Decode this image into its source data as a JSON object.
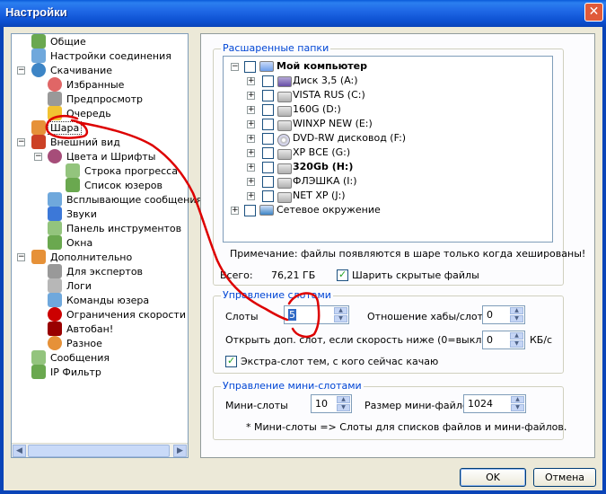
{
  "window": {
    "title": "Настройки",
    "close_glyph": "✕"
  },
  "tree": {
    "items": [
      {
        "label": "Общие",
        "icon": "person-icon",
        "color": "#6aa84f"
      },
      {
        "label": "Настройки соединения",
        "icon": "network-icon",
        "color": "#6fa8dc"
      },
      {
        "label": "Скачивание",
        "icon": "download-globe-icon",
        "color": "#3d85c6"
      },
      {
        "label": "Избранные",
        "icon": "heart-icon",
        "color": "#e06666"
      },
      {
        "label": "Предпросмотр",
        "icon": "preview-icon",
        "color": "#999999"
      },
      {
        "label": "Очередь",
        "icon": "queue-icon",
        "color": "#f1c232"
      },
      {
        "label": "Шара",
        "icon": "share-hand-icon",
        "color": "#e69138"
      },
      {
        "label": "Внешний вид",
        "icon": "appearance-icon",
        "color": "#cc4125"
      },
      {
        "label": "Цвета и Шрифты",
        "icon": "palette-icon",
        "color": "#a64d79"
      },
      {
        "label": "Строка прогресса",
        "icon": "progress-icon",
        "color": "#93c47d"
      },
      {
        "label": "Список юзеров",
        "icon": "users-icon",
        "color": "#6aa84f"
      },
      {
        "label": "Всплывающие сообщения",
        "icon": "popup-icon",
        "color": "#6fa8dc"
      },
      {
        "label": "Звуки",
        "icon": "music-note-icon",
        "color": "#3c78d8"
      },
      {
        "label": "Панель инструментов",
        "icon": "toolbar-icon",
        "color": "#93c47d"
      },
      {
        "label": "Окна",
        "icon": "window-icon",
        "color": "#6aa84f"
      },
      {
        "label": "Дополнительно",
        "icon": "advanced-icon",
        "color": "#e69138"
      },
      {
        "label": "Для экспертов",
        "icon": "expert-icon",
        "color": "#999999"
      },
      {
        "label": "Логи",
        "icon": "log-icon",
        "color": "#b7b7b7"
      },
      {
        "label": "Команды юзера",
        "icon": "commands-icon",
        "color": "#6fa8dc"
      },
      {
        "label": "Ограничения скорости",
        "icon": "speed-limit-icon",
        "color": "#cc0000"
      },
      {
        "label": "Автобан!",
        "icon": "autoban-icon",
        "color": "#990000"
      },
      {
        "label": "Разное",
        "icon": "misc-icon",
        "color": "#e69138"
      },
      {
        "label": "Сообщения",
        "icon": "messages-icon",
        "color": "#93c47d"
      },
      {
        "label": "IP Фильтр",
        "icon": "ip-filter-icon",
        "color": "#6aa84f"
      }
    ]
  },
  "shared_folders": {
    "legend": "Расшаренные папки",
    "items": [
      {
        "label": "Мой компьютер",
        "icon": "computer-icon",
        "bold": true
      },
      {
        "label": "Диск 3,5 (A:)",
        "icon": "floppy-icon"
      },
      {
        "label": "VISTA RUS (C:)",
        "icon": "drive-icon"
      },
      {
        "label": "160G (D:)",
        "icon": "drive-icon"
      },
      {
        "label": "WINXP NEW (E:)",
        "icon": "drive-icon"
      },
      {
        "label": "DVD-RW дисковод (F:)",
        "icon": "dvd-icon"
      },
      {
        "label": "XP ВСЕ (G:)",
        "icon": "drive-icon"
      },
      {
        "label": "320Gb (H:)",
        "icon": "drive-icon",
        "bold": true
      },
      {
        "label": "ФЛЭШКА (I:)",
        "icon": "drive-icon"
      },
      {
        "label": "NET XP (J:)",
        "icon": "drive-icon"
      },
      {
        "label": "Сетевое окружение",
        "icon": "network-places-icon"
      }
    ],
    "note": "Примечание: файлы появляются в шаре только когда хешированы!",
    "total_label": "Всего:",
    "total_value": "76,21 ГБ",
    "share_hidden_label": "Шарить скрытые файлы",
    "share_hidden_checked": true
  },
  "slots": {
    "legend": "Управление слотами",
    "slots_label": "Слоты",
    "slots_value": "5",
    "ratio_label": "Отношение хабы/слоты",
    "ratio_value": "0",
    "extra_slot_label": "Открыть доп. слот, если скорость ниже (0=выкл.)",
    "extra_slot_value": "0",
    "extra_slot_unit": "КБ/с",
    "extra_current_label": "Экстра-слот тем, с кого сейчас качаю",
    "extra_current_checked": true
  },
  "mini_slots": {
    "legend": "Управление мини-слотами",
    "mini_label": "Мини-слоты",
    "mini_value": "10",
    "size_label": "Размер мини-файлов",
    "size_value": "1024",
    "note": "* Мини-слоты => Слоты для списков файлов и мини-файлов."
  },
  "buttons": {
    "ok": "OK",
    "cancel": "Отмена"
  },
  "annotation_color": "#dd0000"
}
